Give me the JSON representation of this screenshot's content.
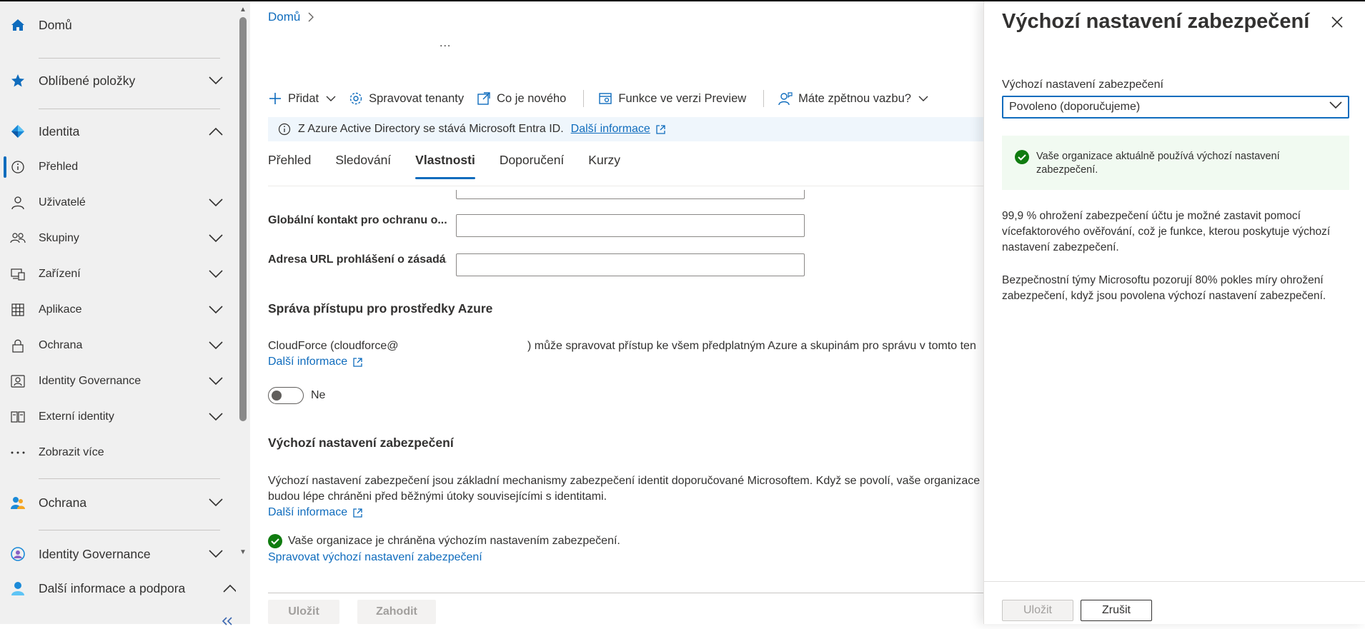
{
  "sidebar": {
    "home": "Domů",
    "favorites": "Oblíbené položky",
    "identity": "Identita",
    "items": [
      {
        "label": "Přehled"
      },
      {
        "label": "Uživatelé"
      },
      {
        "label": "Skupiny"
      },
      {
        "label": "Zařízení"
      },
      {
        "label": "Aplikace"
      },
      {
        "label": "Ochrana"
      },
      {
        "label": "Identity Governance"
      },
      {
        "label": "Externí identity"
      },
      {
        "label": "Zobrazit více"
      }
    ],
    "protection": "Ochrana",
    "identity_governance": "Identity Governance",
    "help": "Další informace a podpora"
  },
  "main": {
    "breadcrumb": "Domů",
    "ellipsis": "...",
    "toolbar": {
      "add": "Přidat",
      "manage_tenants": "Spravovat tenanty",
      "whats_new": "Co je nového",
      "preview": "Funkce ve verzi Preview",
      "feedback": "Máte zpětnou vazbu?"
    },
    "banner": {
      "text": "Z Azure Active Directory se stává Microsoft Entra ID.",
      "link": "Další informace"
    },
    "tabs": [
      "Přehled",
      "Sledování",
      "Vlastnosti",
      "Doporučení",
      "Kurzy"
    ],
    "fields": {
      "global_contact": "Globální kontakt pro ochranu o...",
      "privacy_url": "Adresa URL prohlášení o zásadá..."
    },
    "azure_access": {
      "heading": "Správa přístupu pro prostředky Azure",
      "text_a": "CloudForce (cloudforce@",
      "text_b": ") může spravovat přístup ke všem předplatným Azure a skupinám pro správu v tomto ten",
      "link": "Další informace",
      "toggle_label": "Ne"
    },
    "security_defaults": {
      "heading": "Výchozí nastavení zabezpečení",
      "line1": "Výchozí nastavení zabezpečení jsou základní mechanismy zabezpečení identit doporučované Microsoftem. Když se povolí, vaše organizace b",
      "line2": "budou lépe chráněni před běžnými útoky souvisejícími s identitami.",
      "link": "Další informace",
      "status": "Vaše organizace je chráněna výchozím nastavením zabezpečení.",
      "manage_link": "Spravovat výchozí nastavení zabezpečení"
    },
    "save": "Uložit",
    "discard": "Zahodit"
  },
  "panel": {
    "title": "Výchozí nastavení zabezpečení",
    "select_label": "Výchozí nastavení zabezpečení",
    "select_value": "Povoleno (doporučujeme)",
    "success_text": "Vaše organizace aktuálně používá výchozí nastavení zabezpečení.",
    "para1": "99,9 % ohrožení zabezpečení účtu je možné zastavit pomocí vícefaktorového ověřování, což je funkce, kterou poskytuje výchozí nastavení zabezpečení.",
    "para2": "Bezpečnostní týmy Microsoftu pozorují 80% pokles míry ohrožení zabezpečení, když jsou povolena výchozí nastavení zabezpečení.",
    "save": "Uložit",
    "cancel": "Zrušit"
  },
  "colors": {
    "accent": "#0f6cbd",
    "success": "#107c10",
    "sidebar_bg": "#f0f0f0"
  }
}
